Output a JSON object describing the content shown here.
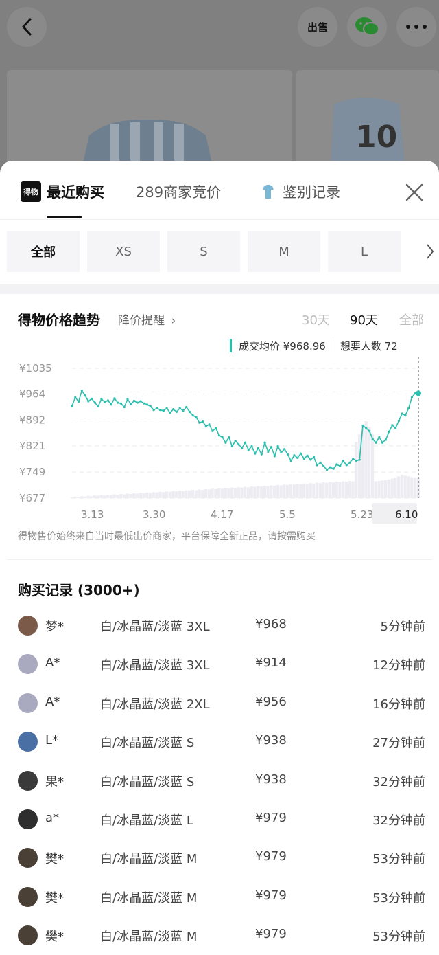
{
  "header": {
    "back_icon": "chevron-left-icon",
    "sell_icon_label": "出售",
    "wechat_icon": "wechat-icon",
    "more_icon": "more-dots-icon"
  },
  "tabs": {
    "brand_label": "得物",
    "recent": "最近购买",
    "bids": "289商家竞价",
    "appraisal": "鉴别记录",
    "close_icon": "close-icon"
  },
  "sizes": [
    "全部",
    "XS",
    "S",
    "M",
    "L"
  ],
  "trend": {
    "title": "得物价格趋势",
    "drop_alert": "降价提醒",
    "ranges": [
      "30天",
      "90天",
      "全部"
    ],
    "selected_range": "90天",
    "tooltip_avg": "成交均价 ¥968.96",
    "tooltip_want": "想要人数 72",
    "disclaimer": "得物售价始终来自当时最低出价商家，平台保障全新正品，请按需购买"
  },
  "chart_data": {
    "type": "line",
    "x_ticks": [
      "3.13",
      "3.30",
      "4.17",
      "5.5",
      "5.23",
      "6.10"
    ],
    "selected_x": "6.10",
    "y_ticks": [
      "¥1035",
      "¥964",
      "¥892",
      "¥821",
      "¥749",
      "¥677"
    ],
    "ylim": [
      677,
      1035
    ],
    "accent_color": "#2bbfae",
    "series": [
      {
        "values": [
          931,
          955,
          943,
          973,
          960,
          944,
          951,
          940,
          930,
          950,
          942,
          946,
          935,
          952,
          940,
          938,
          928,
          950,
          936,
          945,
          940,
          944,
          938,
          935,
          930,
          920,
          925,
          920,
          918,
          925,
          912,
          922,
          915,
          925,
          918,
          928,
          915,
          905,
          900,
          885,
          888,
          875,
          880,
          862,
          870,
          850,
          845,
          830,
          845,
          820,
          835,
          825,
          815,
          830,
          810,
          820,
          800,
          815,
          798,
          830,
          805,
          818,
          793,
          820,
          803,
          812,
          798,
          780,
          795,
          788,
          800,
          786,
          794,
          783,
          790,
          768,
          775,
          765,
          755,
          762,
          758,
          770,
          765,
          780,
          768,
          775,
          786,
          780,
          783,
          877,
          870,
          862,
          840,
          830,
          845,
          830,
          838,
          860,
          878,
          870,
          890,
          910,
          905,
          925,
          955,
          966,
          966
        ]
      }
    ],
    "volume": [
      2,
      4,
      3,
      5,
      4,
      6,
      5,
      7,
      6,
      8,
      7,
      9,
      8,
      10,
      9,
      11,
      10,
      12,
      11,
      13,
      12,
      14,
      13,
      15,
      14,
      16,
      15,
      17,
      16,
      18,
      17,
      19,
      18,
      20,
      19,
      21,
      20,
      22,
      21,
      23,
      22,
      24,
      23,
      25,
      24,
      26,
      25,
      27,
      26,
      28,
      27,
      29,
      28,
      30,
      29,
      31,
      30,
      32,
      31,
      33,
      32,
      34,
      33,
      35,
      34,
      36,
      35,
      37,
      36,
      38,
      37,
      39,
      38,
      40,
      39,
      41,
      40,
      42,
      41,
      43,
      42,
      44,
      43,
      45,
      44,
      46,
      45,
      150,
      170,
      190,
      205,
      190,
      170,
      45,
      46,
      47,
      48,
      50,
      52,
      55,
      58,
      62,
      60,
      58,
      56,
      55,
      54
    ],
    "grid": true
  },
  "records": {
    "title": "购买记录 (3000+)",
    "rows": [
      {
        "name": "梦*",
        "sku": "白/冰晶蓝/淡蓝 3XL",
        "price": "¥968",
        "time": "5分钟前",
        "avatar_color": "#7b5a4a"
      },
      {
        "name": "A*",
        "sku": "白/冰晶蓝/淡蓝 3XL",
        "price": "¥914",
        "time": "12分钟前",
        "avatar_color": "#a9a9c0"
      },
      {
        "name": "A*",
        "sku": "白/冰晶蓝/淡蓝 2XL",
        "price": "¥956",
        "time": "16分钟前",
        "avatar_color": "#a9a9c0"
      },
      {
        "name": "L*",
        "sku": "白/冰晶蓝/淡蓝 S",
        "price": "¥938",
        "time": "27分钟前",
        "avatar_color": "#4a6fa5"
      },
      {
        "name": "果*",
        "sku": "白/冰晶蓝/淡蓝 S",
        "price": "¥938",
        "time": "32分钟前",
        "avatar_color": "#3a3a3a"
      },
      {
        "name": "a*",
        "sku": "白/冰晶蓝/淡蓝 L",
        "price": "¥979",
        "time": "32分钟前",
        "avatar_color": "#2f2f2f"
      },
      {
        "name": "樊*",
        "sku": "白/冰晶蓝/淡蓝 M",
        "price": "¥979",
        "time": "53分钟前",
        "avatar_color": "#4a4036"
      },
      {
        "name": "樊*",
        "sku": "白/冰晶蓝/淡蓝 M",
        "price": "¥979",
        "time": "53分钟前",
        "avatar_color": "#4a4036"
      },
      {
        "name": "樊*",
        "sku": "白/冰晶蓝/淡蓝 M",
        "price": "¥979",
        "time": "53分钟前",
        "avatar_color": "#4a4036"
      }
    ]
  }
}
